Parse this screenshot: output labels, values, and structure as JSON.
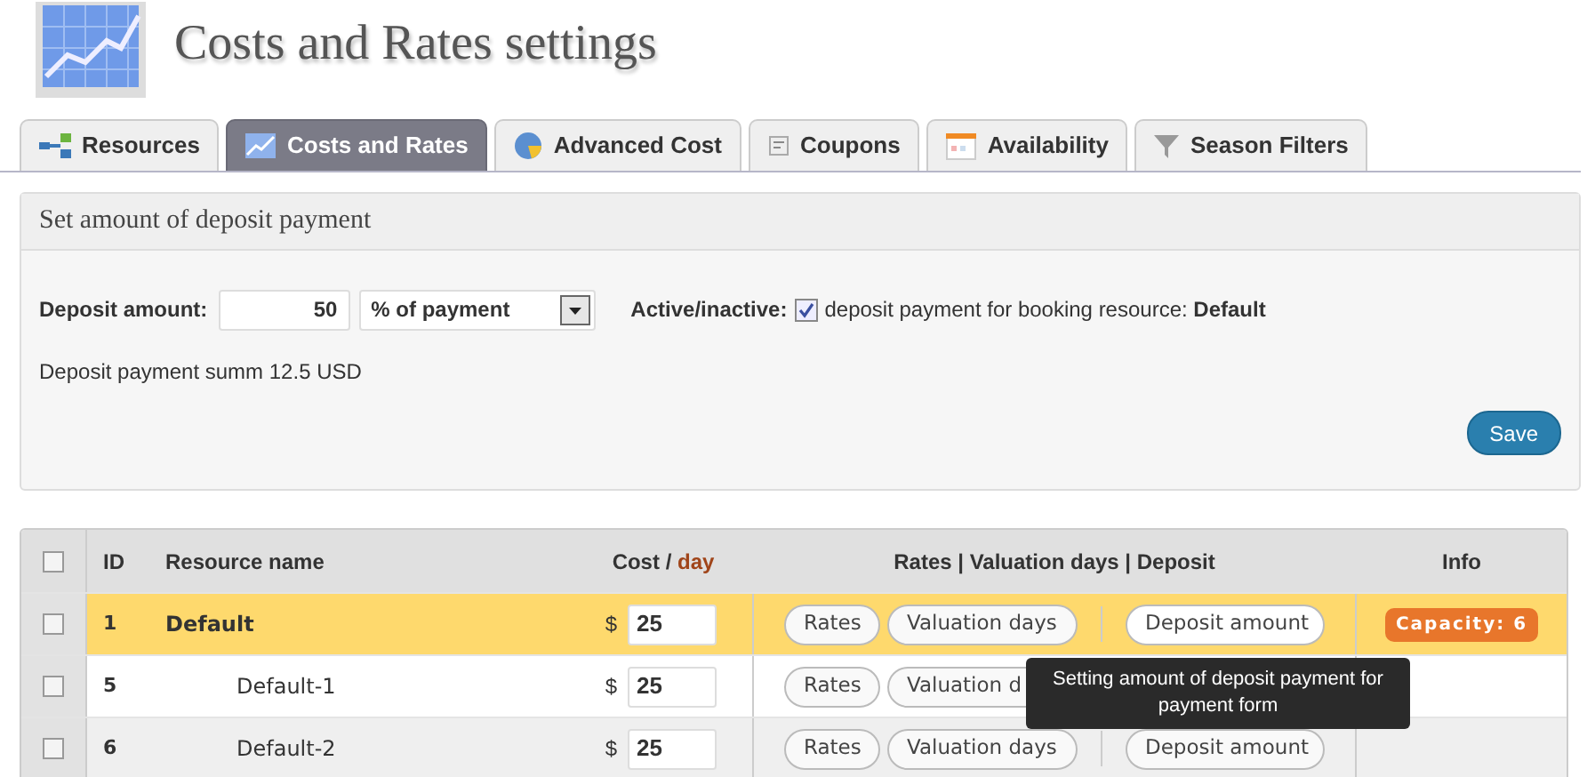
{
  "page": {
    "title": "Costs and Rates settings"
  },
  "tabs": [
    {
      "label": "Resources",
      "selected": false
    },
    {
      "label": "Costs and Rates",
      "selected": true
    },
    {
      "label": "Advanced Cost",
      "selected": false
    },
    {
      "label": "Coupons",
      "selected": false
    },
    {
      "label": "Availability",
      "selected": false
    },
    {
      "label": "Season Filters",
      "selected": false
    }
  ],
  "deposit_panel": {
    "title": "Set amount of deposit payment",
    "amount_label": "Deposit amount:",
    "amount_value": "50",
    "type_value": "% of payment",
    "active_label": "Active/inactive:",
    "active_checked": true,
    "active_text": "deposit payment for booking resource: **Default**",
    "summary": "Deposit payment summ 12.5 USD",
    "save_button": "Save"
  },
  "table": {
    "select_all_checked": false,
    "columns": [
      "ID",
      "Resource name",
      "Cost / day",
      "Rates | Valuation days | Deposit",
      "Info"
    ],
    "rows": [
      {
        "checked": false,
        "highlighted": true,
        "id": "1",
        "name": "Default",
        "currency": "$",
        "cost": "25",
        "buttons": [
          "Rates",
          "Valuation days",
          "Deposit amount"
        ],
        "badge": "Capacity: 6",
        "children": [
          {
            "checked": false,
            "highlighted": false,
            "id": "5",
            "name": "Default-1",
            "currency": "$",
            "cost": "25",
            "buttons": [
              "Rates",
              "Valuation d"
            ]
          },
          {
            "checked": false,
            "highlighted": false,
            "id": "6",
            "name": "Default-2",
            "currency": "$",
            "cost": "25",
            "buttons": [
              "Rates",
              "Valuation days",
              "Deposit amount"
            ]
          }
        ]
      }
    ]
  },
  "tooltip": {
    "text": "Setting amount of deposit payment for payment form"
  }
}
